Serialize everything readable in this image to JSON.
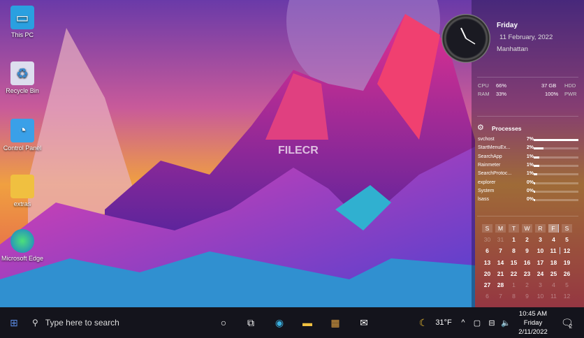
{
  "desktop_icons": [
    {
      "label": "This PC",
      "icon": "monitor-icon"
    },
    {
      "label": "Recycle Bin",
      "icon": "recycle-bin-icon"
    },
    {
      "label": "Control Panel",
      "icon": "control-panel-icon"
    },
    {
      "label": "extras",
      "icon": "folder-icon"
    },
    {
      "label": "Microsoft Edge",
      "icon": "edge-icon"
    }
  ],
  "watermark": "FILECR",
  "widget": {
    "day": "Friday",
    "date": "11 February, 2022",
    "location": "Manhattan",
    "stats": {
      "cpu_label": "CPU",
      "cpu": "66%",
      "ram_label": "RAM",
      "ram": "33%",
      "hdd": "37 GB",
      "hdd_label": "HDD",
      "pwr": "100%",
      "pwr_label": "PWR"
    },
    "processes_title": "Processes",
    "processes": [
      {
        "name": "svchost",
        "value": "7%",
        "pct": 100
      },
      {
        "name": "StartMenuEx...",
        "value": "2%",
        "pct": 22
      },
      {
        "name": "SearchApp",
        "value": "1%",
        "pct": 12
      },
      {
        "name": "Rainmeter",
        "value": "1%",
        "pct": 12
      },
      {
        "name": "SearchProtoc...",
        "value": "1%",
        "pct": 8
      },
      {
        "name": "explorer",
        "value": "0%",
        "pct": 3
      },
      {
        "name": "System",
        "value": "0%",
        "pct": 3
      },
      {
        "name": "lsass",
        "value": "0%",
        "pct": 3
      }
    ],
    "calendar": {
      "headers": [
        "S",
        "M",
        "T",
        "W",
        "R",
        "F",
        "S"
      ],
      "today_col": 5,
      "today": "11",
      "days": [
        "30",
        "31",
        "1",
        "2",
        "3",
        "4",
        "5",
        "6",
        "7",
        "8",
        "9",
        "10",
        "11",
        "12",
        "13",
        "14",
        "15",
        "16",
        "17",
        "18",
        "19",
        "20",
        "21",
        "22",
        "23",
        "24",
        "25",
        "26",
        "27",
        "28",
        "1",
        "2",
        "3",
        "4",
        "5",
        "6",
        "7",
        "8",
        "9",
        "10",
        "11",
        "12"
      ]
    }
  },
  "taskbar": {
    "search_placeholder": "Type here to search",
    "weather": "31°F",
    "time": "10:45 AM",
    "day": "Friday",
    "date": "2/11/2022",
    "notifications": "2"
  }
}
